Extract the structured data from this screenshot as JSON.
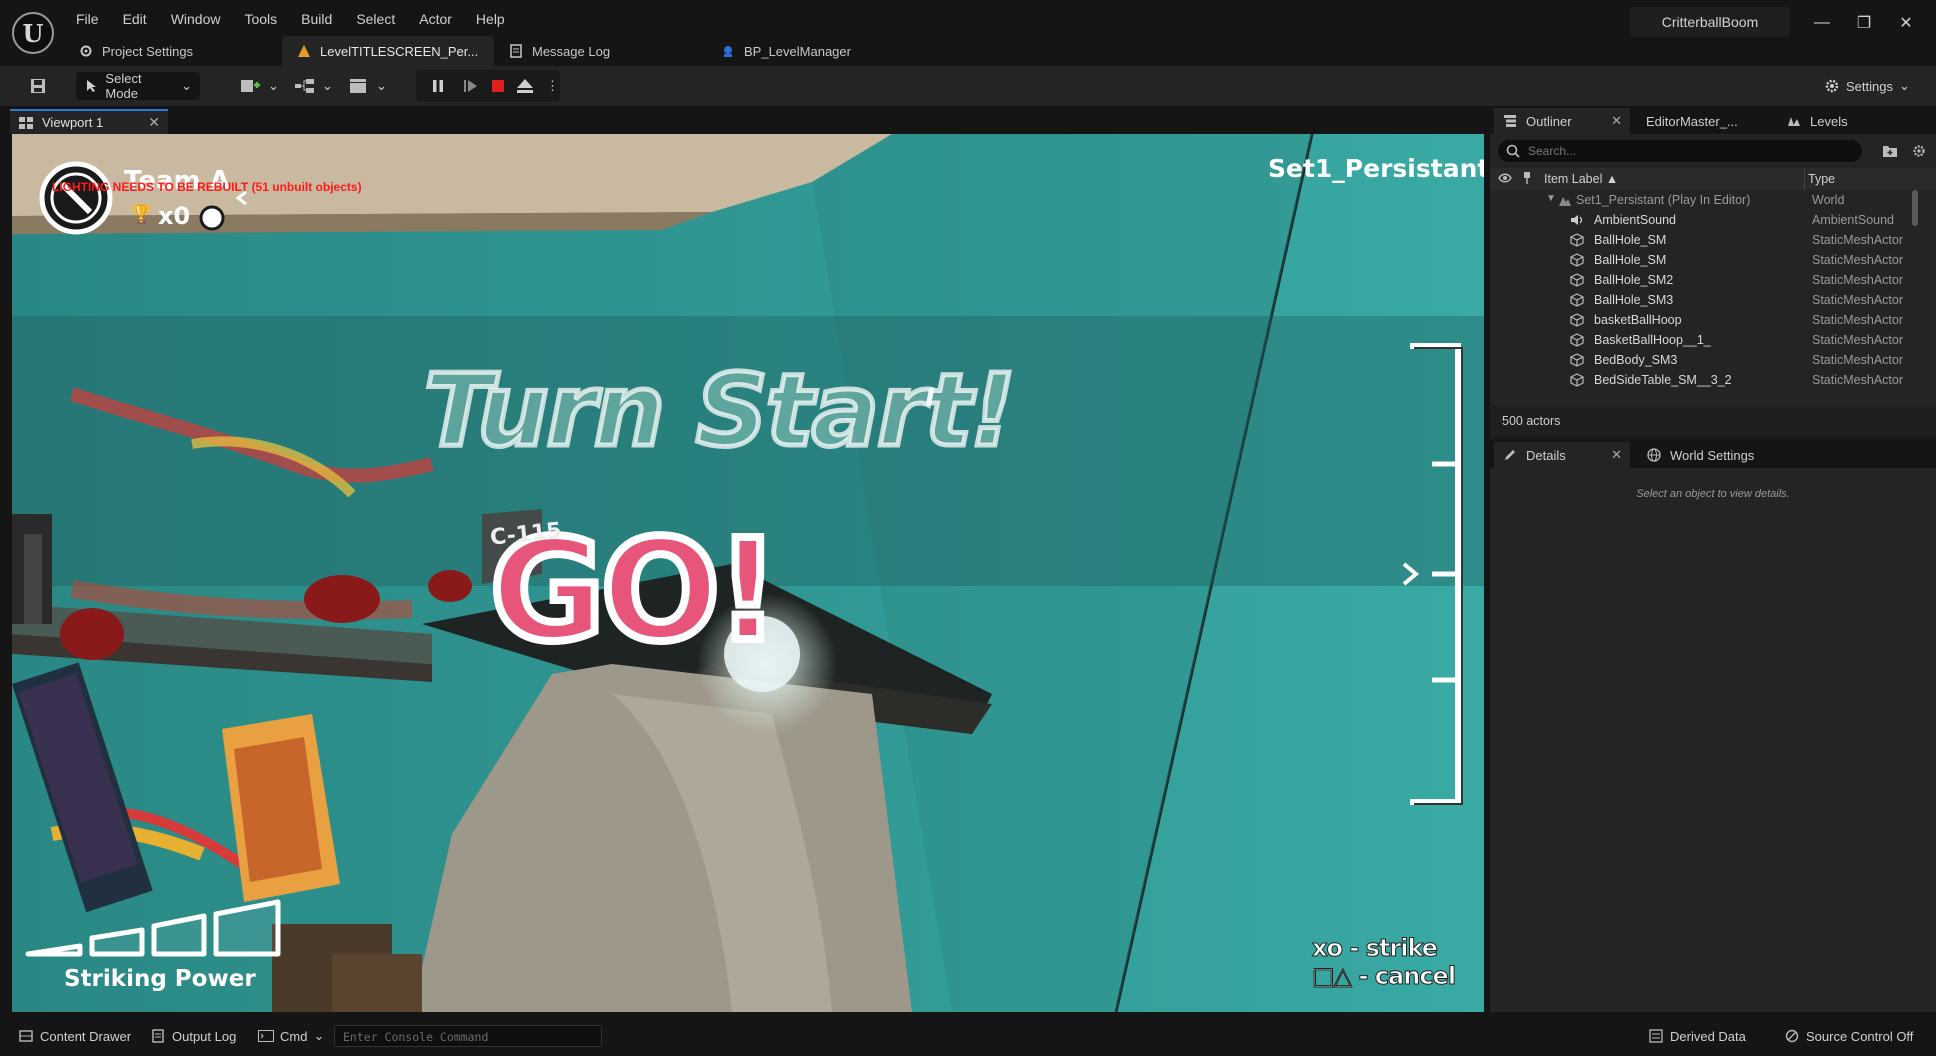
{
  "app": {
    "project_name": "CritterballBoom"
  },
  "menu": [
    "File",
    "Edit",
    "Window",
    "Tools",
    "Build",
    "Select",
    "Actor",
    "Help"
  ],
  "doc_tabs": [
    {
      "label": "Project Settings",
      "icon": "gear-icon"
    },
    {
      "label": "LevelTITLESCREEN_Per...",
      "icon": "level-warning-icon"
    },
    {
      "label": "Message Log",
      "icon": "log-icon"
    },
    {
      "label": "BP_LevelManager",
      "icon": "blueprint-icon"
    }
  ],
  "toolbar": {
    "select_mode": "Select Mode",
    "settings": "Settings"
  },
  "viewport": {
    "tab_label": "Viewport 1",
    "level_name": "Set1_Persistant",
    "team_label": "Team A",
    "lighting_warning": "LIGHTING NEEDS TO BE REBUILT (51 unbuilt objects)",
    "score": "x0",
    "turn_start": "Turn Start!",
    "go_text": "GO!",
    "poster_label": "C-115",
    "striking_power": "Striking Power",
    "strike_hint": "xo - strike",
    "cancel_hint": "□△ - cancel",
    "power_level": 4
  },
  "outliner": {
    "tab_label": "Outliner",
    "tab2_label": "EditorMaster_...",
    "tab3_label": "Levels",
    "search_placeholder": "Search...",
    "col_label": "Item Label ▲",
    "col_type": "Type",
    "root": {
      "label": "Set1_Persistant (Play In Editor)",
      "type": "World"
    },
    "rows": [
      {
        "label": "AmbientSound",
        "type": "AmbientSound",
        "icon": "sound-icon"
      },
      {
        "label": "BallHole_SM",
        "type": "StaticMeshActor",
        "icon": "mesh-icon"
      },
      {
        "label": "BallHole_SM",
        "type": "StaticMeshActor",
        "icon": "mesh-icon"
      },
      {
        "label": "BallHole_SM2",
        "type": "StaticMeshActor",
        "icon": "mesh-icon"
      },
      {
        "label": "BallHole_SM3",
        "type": "StaticMeshActor",
        "icon": "mesh-icon"
      },
      {
        "label": "basketBallHoop",
        "type": "StaticMeshActor",
        "icon": "mesh-icon"
      },
      {
        "label": "BasketBallHoop__1_",
        "type": "StaticMeshActor",
        "icon": "mesh-icon"
      },
      {
        "label": "BedBody_SM3",
        "type": "StaticMeshActor",
        "icon": "mesh-icon"
      },
      {
        "label": "BedSideTable_SM__3_2",
        "type": "StaticMeshActor",
        "icon": "mesh-icon"
      }
    ],
    "actor_count": "500 actors"
  },
  "details": {
    "tab_label": "Details",
    "tab2_label": "World Settings",
    "empty_text": "Select an object to view details."
  },
  "statusbar": {
    "content_drawer": "Content Drawer",
    "output_log": "Output Log",
    "cmd": "Cmd",
    "console_placeholder": "Enter Console Command",
    "derived_data": "Derived Data",
    "source_control": "Source Control Off"
  },
  "colors": {
    "accent": "#2a78d8",
    "stop_red": "#e02020",
    "wall_teal": "#2c8a87",
    "go_pink": "#e8557a"
  }
}
